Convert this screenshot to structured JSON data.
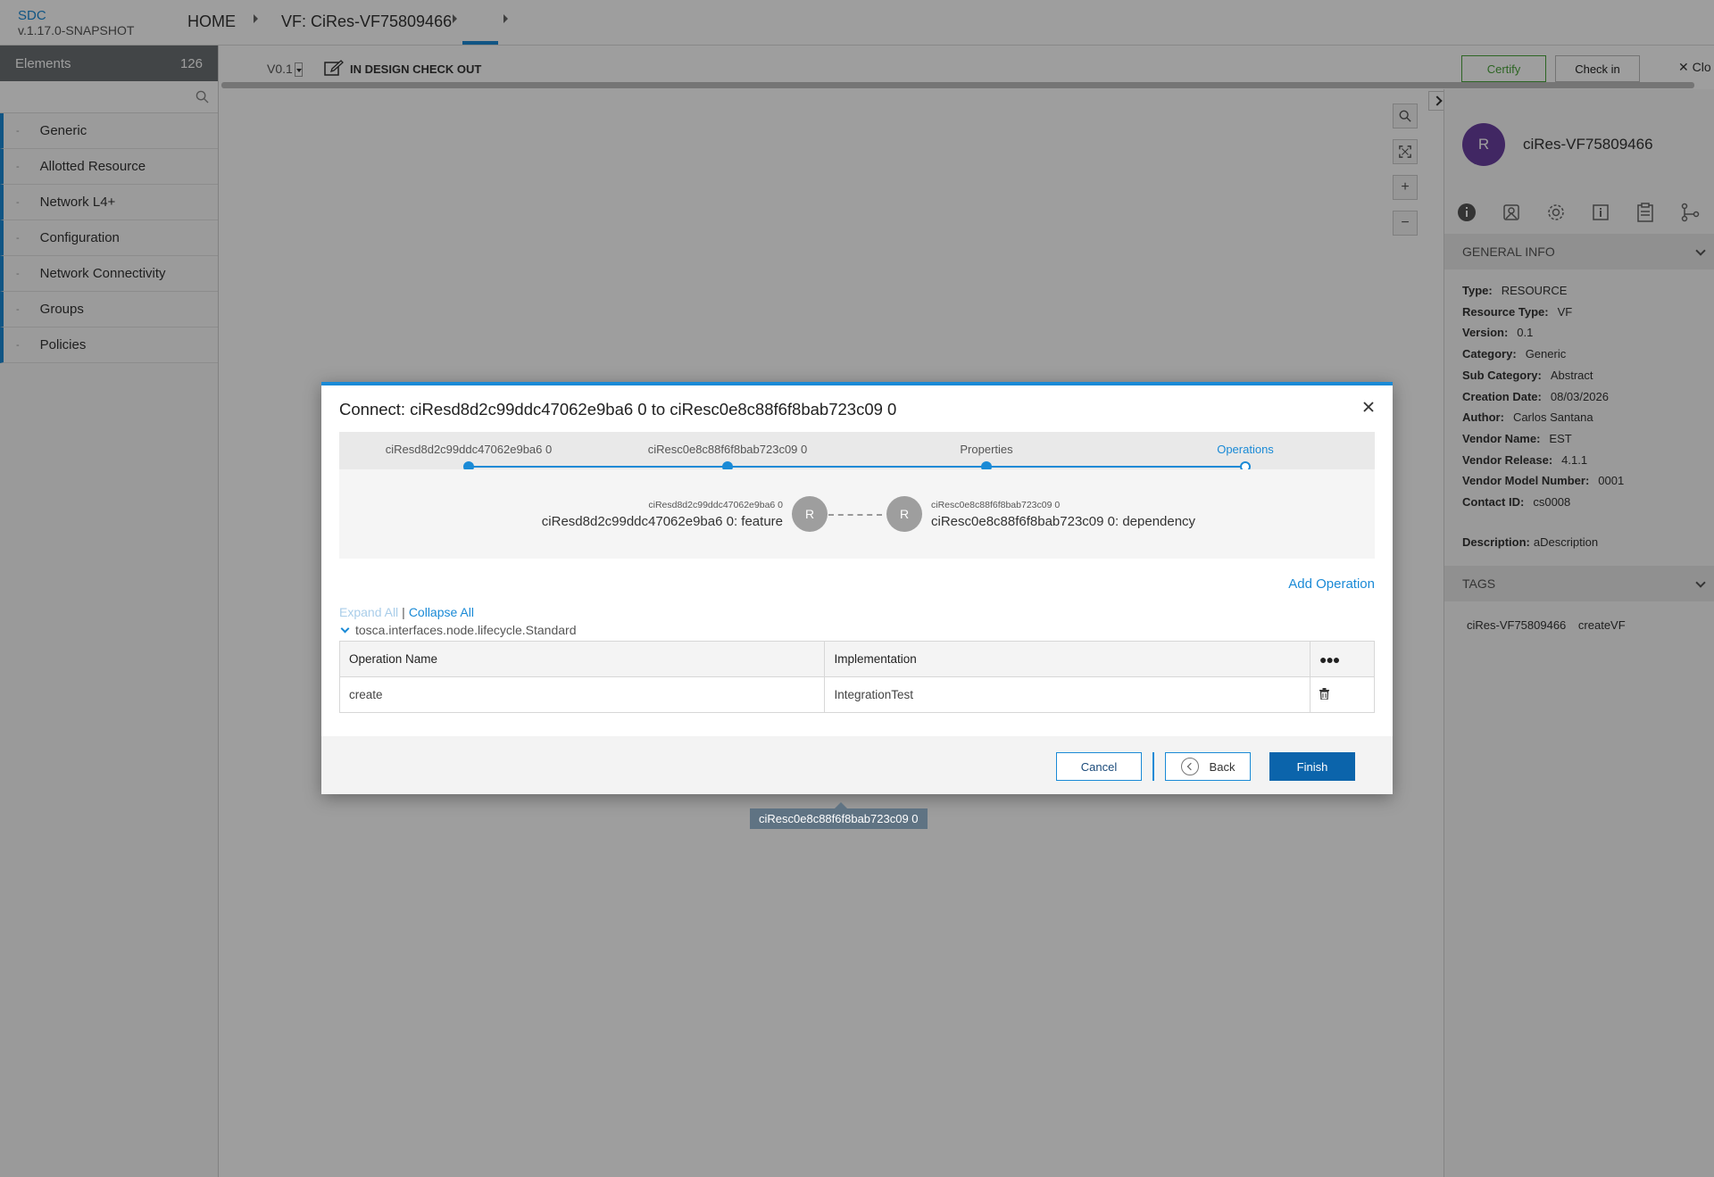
{
  "header": {
    "brand": "SDC",
    "version": "v.1.17.0-SNAPSHOT",
    "home": "HOME",
    "vf_title": "VF: CiRes-VF75809466"
  },
  "palette": {
    "title": "Elements",
    "count": "126",
    "search_placeholder": "",
    "items": [
      {
        "label": "Generic"
      },
      {
        "label": "Allotted Resource"
      },
      {
        "label": "Network L4+"
      },
      {
        "label": "Configuration"
      },
      {
        "label": "Network Connectivity"
      },
      {
        "label": "Groups"
      },
      {
        "label": "Policies"
      }
    ]
  },
  "canvas_bar": {
    "version": "V0.1",
    "state": "IN DESIGN CHECK OUT",
    "certify": "Certify",
    "checkin": "Check in",
    "close": "Clo"
  },
  "right_panel": {
    "avatar": "R",
    "title": "ciRes-VF75809466",
    "general_info_title": "GENERAL INFO",
    "info": [
      {
        "label": "Type:",
        "value": "RESOURCE"
      },
      {
        "label": "Resource Type:",
        "value": "VF"
      },
      {
        "label": "Version:",
        "value": "0.1"
      },
      {
        "label": "Category:",
        "value": "Generic"
      },
      {
        "label": "Sub Category:",
        "value": "Abstract"
      },
      {
        "label": "Creation Date:",
        "value": "08/03/2026"
      },
      {
        "label": "Author:",
        "value": "Carlos Santana"
      },
      {
        "label": "Vendor Name:",
        "value": "EST"
      },
      {
        "label": "Vendor Release:",
        "value": "4.1.1"
      },
      {
        "label": "Vendor Model Number:",
        "value": "0001"
      },
      {
        "label": "Contact ID:",
        "value": "cs0008"
      }
    ],
    "description_label": "Description:",
    "description_value": "aDescription",
    "tags_title": "TAGS",
    "tags": [
      "ciRes-VF75809466",
      "createVF"
    ]
  },
  "modal": {
    "title": "Connect: ciResd8d2c99ddc47062e9ba6 0 to ciResc0e8c88f6f8bab723c09 0",
    "steps": [
      {
        "label": "ciResd8d2c99ddc47062e9ba6 0"
      },
      {
        "label": "ciResc0e8c88f6f8bab723c09 0"
      },
      {
        "label": "Properties"
      },
      {
        "label": "Operations"
      }
    ],
    "relation": {
      "from_small": "ciResd8d2c99ddc47062e9ba6 0",
      "from_big": "ciResd8d2c99ddc47062e9ba6 0: feature",
      "from_node": "R",
      "to_node": "R",
      "to_small": "ciResc0e8c88f6f8bab723c09 0",
      "to_big": "ciResc0e8c88f6f8bab723c09 0: dependency"
    },
    "add_operation": "Add Operation",
    "expand_all": "Expand All",
    "separator": "|",
    "collapse_all": "Collapse All",
    "interface_name": "tosca.interfaces.node.lifecycle.Standard",
    "table": {
      "headers": [
        "Operation Name",
        "Implementation",
        "●●●"
      ],
      "rows": [
        {
          "name": "create",
          "implementation": "IntegrationTest"
        }
      ]
    },
    "buttons": {
      "cancel": "Cancel",
      "back": "Back",
      "finish": "Finish"
    }
  },
  "tooltip": "ciResc0e8c88f6f8bab723c09 0",
  "colors": {
    "accent": "#1a8ad6",
    "finish": "#0b64ab",
    "certify": "#4aa33a",
    "avatar": "#6a3fa0"
  }
}
